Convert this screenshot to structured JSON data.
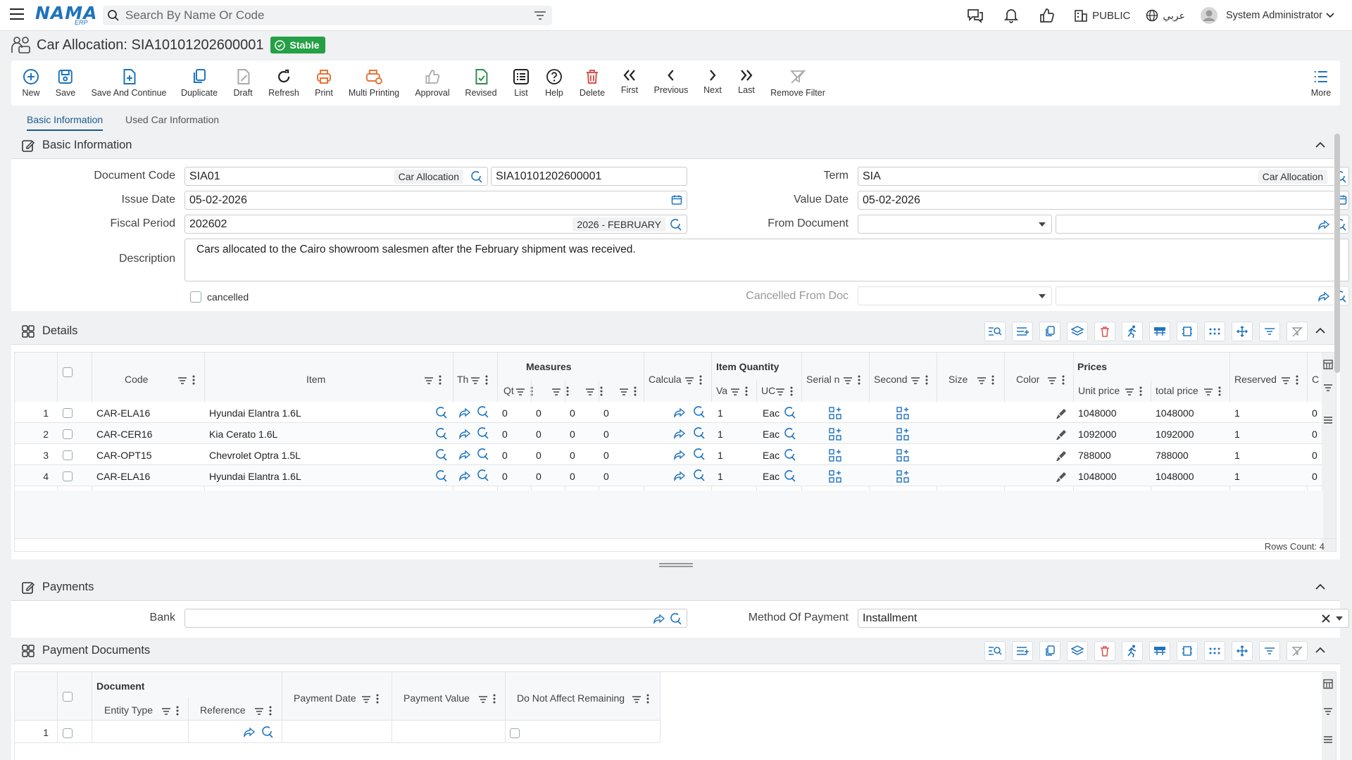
{
  "app": {
    "logo_text": "NAMA",
    "logo_sub": "ERP",
    "search_placeholder": "Search By Name Or Code",
    "public_label": "PUBLIC",
    "language_label": "عربي",
    "user_name": "System Administrator"
  },
  "page": {
    "title": "Car Allocation: SIA10101202600001",
    "status": "Stable"
  },
  "toolbar": {
    "new": "New",
    "save": "Save",
    "save_continue": "Save And Continue",
    "duplicate": "Duplicate",
    "draft": "Draft",
    "refresh": "Refresh",
    "print": "Print",
    "multi_printing": "Multi Printing",
    "approval": "Approval",
    "revised": "Revised",
    "list": "List",
    "help": "Help",
    "delete": "Delete",
    "first": "First",
    "previous": "Previous",
    "next": "Next",
    "last": "Last",
    "remove_filter": "Remove Filter",
    "more": "More"
  },
  "tabs": {
    "basic": "Basic Information",
    "used_car": "Used Car Information"
  },
  "basic": {
    "section_title": "Basic Information",
    "document_code_label": "Document Code",
    "document_code": "SIA01",
    "document_code_tag": "Car Allocation",
    "document_number": "SIA10101202600001",
    "term_label": "Term",
    "term": "SIA",
    "term_tag": "Car Allocation",
    "issue_date_label": "Issue Date",
    "issue_date": "05-02-2026",
    "value_date_label": "Value Date",
    "value_date": "05-02-2026",
    "fiscal_period_label": "Fiscal Period",
    "fiscal_period": "202602",
    "fiscal_period_tag": "2026 - FEBRUARY",
    "from_document_label": "From Document",
    "description_label": "Description",
    "description": "Cars allocated to the Cairo showroom salesmen after the February shipment was received.",
    "cancelled_label": "cancelled",
    "cancelled_from_doc_label": "Cancelled From Doc"
  },
  "details": {
    "section_title": "Details",
    "group_measures": "Measures",
    "group_item_quantity": "Item Quantity",
    "group_prices": "Prices",
    "columns": {
      "code": "Code",
      "item": "Item",
      "th": "Th",
      "qt": "Qt",
      "calcul": "Calcula",
      "va": "Va",
      "uc": "UC",
      "serial": "Serial n",
      "second": "Second",
      "size": "Size",
      "color": "Color",
      "unit_price": "Unit price",
      "total_price": "total price",
      "reserved": "Reserved",
      "c": "C"
    },
    "rows": [
      {
        "n": "1",
        "code": "CAR-ELA16",
        "item": "Hyundai Elantra 1.6L",
        "m1": "0",
        "m2": "0",
        "m3": "0",
        "m4": "0",
        "va": "1",
        "uc": "Eac",
        "unit_price": "1048000",
        "total_price": "1048000",
        "reserved": "1",
        "c": "0"
      },
      {
        "n": "2",
        "code": "CAR-CER16",
        "item": "Kia Cerato 1.6L",
        "m1": "0",
        "m2": "0",
        "m3": "0",
        "m4": "0",
        "va": "1",
        "uc": "Eac",
        "unit_price": "1092000",
        "total_price": "1092000",
        "reserved": "1",
        "c": "0"
      },
      {
        "n": "3",
        "code": "CAR-OPT15",
        "item": "Chevrolet Optra 1.5L",
        "m1": "0",
        "m2": "0",
        "m3": "0",
        "m4": "0",
        "va": "1",
        "uc": "Eac",
        "unit_price": "788000",
        "total_price": "788000",
        "reserved": "1",
        "c": "0"
      },
      {
        "n": "4",
        "code": "CAR-ELA16",
        "item": "Hyundai Elantra 1.6L",
        "m1": "0",
        "m2": "0",
        "m3": "0",
        "m4": "0",
        "va": "1",
        "uc": "Eac",
        "unit_price": "1048000",
        "total_price": "1048000",
        "reserved": "1",
        "c": "0"
      }
    ],
    "rows_count": "Rows Count: 4"
  },
  "payments": {
    "section_title": "Payments",
    "bank_label": "Bank",
    "method_label": "Method Of Payment",
    "method": "Installment"
  },
  "payment_documents": {
    "section_title": "Payment Documents",
    "group_document": "Document",
    "entity_type": "Entity Type",
    "reference": "Reference",
    "payment_date": "Payment Date",
    "payment_value": "Payment Value",
    "do_not_affect": "Do Not Affect Remaining",
    "row_number": "1"
  },
  "colors": {
    "accent": "#1e73be",
    "stable": "#25a046",
    "danger": "#d9534f",
    "print": "#e8743b",
    "revised": "#2f8f4e"
  }
}
